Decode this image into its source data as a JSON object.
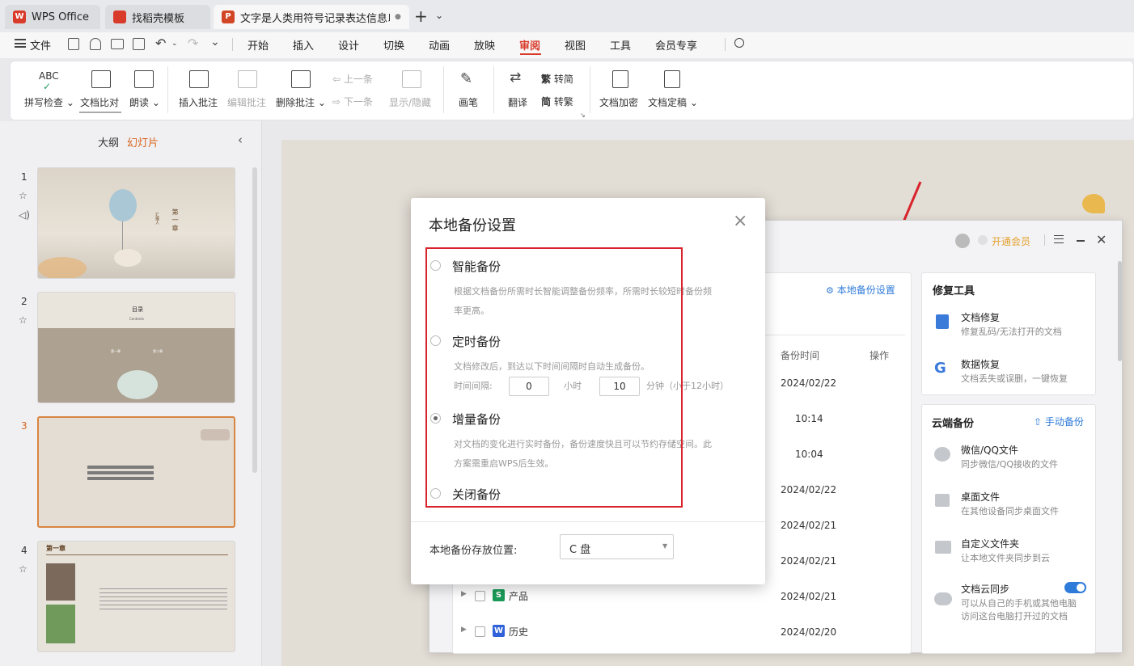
{
  "tabs": [
    {
      "label": "WPS Office",
      "color": "#d93b2b"
    },
    {
      "label": "找稻壳模板",
      "color": "#d93b2b"
    },
    {
      "label": "文字是人类用符号记录表达信息以",
      "color": "#d24625",
      "dot": "●"
    }
  ],
  "tab_add": "+",
  "tab_more": "⌄",
  "menu": {
    "file": "文件",
    "items": [
      "开始",
      "插入",
      "设计",
      "切换",
      "动画",
      "放映",
      "审阅",
      "视图",
      "工具",
      "会员专享"
    ],
    "active": "审阅"
  },
  "ribbon": {
    "spell_abc": "ABC",
    "spell_check": "拼写检查",
    "compare": "文档比对",
    "read_aloud": "朗读",
    "insert_comment": "插入批注",
    "edit_comment": "编辑批注",
    "delete_comment": "删除批注",
    "prev": "上一条",
    "next": "下一条",
    "show_hide": "显示/隐藏",
    "pen": "画笔",
    "translate": "翻译",
    "to_simplified": "转简",
    "to_traditional": "转繁",
    "simplified_char": "繁",
    "traditional_char": "简",
    "encrypt": "文档加密",
    "finalize": "文档定稿"
  },
  "left_pane": {
    "outline": "大纲",
    "slides": "幻灯片",
    "slide_numbers": [
      "1",
      "2",
      "3",
      "4"
    ],
    "slide1_title": "第一章",
    "slide1_sub": "汇报人",
    "slide2_title": "目录",
    "slide2_sub": "Contents",
    "slide2_item1": "第一章",
    "slide2_item2": "第二章",
    "slide4_title": "第一章"
  },
  "backup_window": {
    "vip": "开通会员",
    "local_backup_settings": "本地备份设置",
    "col_time": "备份时间",
    "col_action": "操作",
    "rows": [
      {
        "name": "",
        "date": "2024/02/22"
      },
      {
        "name": "",
        "date": "10:14"
      },
      {
        "name": "",
        "date": "10:04"
      },
      {
        "name": "",
        "date": "2024/02/22"
      },
      {
        "name": "",
        "date": "2024/02/21"
      },
      {
        "name": "",
        "date": "2024/02/21"
      },
      {
        "name": "产品",
        "date": "2024/02/21",
        "badge": "S",
        "badge_color": "#1a9b58"
      },
      {
        "name": "历史",
        "date": "2024/02/20",
        "badge": "W",
        "badge_color": "#2f62d9"
      }
    ],
    "repair_title": "修复工具",
    "repair_items": [
      {
        "title": "文档修复",
        "desc": "修复乱码/无法打开的文档"
      },
      {
        "title": "数据恢复",
        "desc": "文档丢失或误删，一键恢复"
      }
    ],
    "cloud_title": "云端备份",
    "manual_backup": "手动备份",
    "cloud_items": [
      {
        "title": "微信/QQ文件",
        "desc": "同步微信/QQ接收的文件"
      },
      {
        "title": "桌面文件",
        "desc": "在其他设备同步桌面文件"
      },
      {
        "title": "自定义文件夹",
        "desc": "让本地文件夹同步到云"
      },
      {
        "title": "文档云同步",
        "desc": "可以从自己的手机或其他电脑",
        "desc2": "访问这台电脑打开过的文档"
      }
    ]
  },
  "modal": {
    "title": "本地备份设置",
    "close": "×",
    "options": [
      {
        "label": "智能备份",
        "desc1": "根据文档备份所需时长智能调整备份频率，所需时长较短时备份频",
        "desc2": "率更高。",
        "selected": false
      },
      {
        "label": "定时备份",
        "desc1": "文档修改后，到达以下时间间隔时自动生成备份。",
        "selected": false
      },
      {
        "label": "增量备份",
        "desc1": "对文档的变化进行实时备份，备份速度快且可以节约存储空间。此",
        "desc2": "方案需重启WPS后生效。",
        "selected": true
      },
      {
        "label": "关闭备份",
        "selected": false
      }
    ],
    "interval_label": "时间间隔:",
    "hours_value": "0",
    "hours_unit": "小时",
    "minutes_value": "10",
    "minutes_unit": "分钟（小于12小时）",
    "location_label": "本地备份存放位置:",
    "location_value": "C 盘"
  },
  "colors": {
    "accent": "#d93b2b",
    "highlight_box": "#d9232b",
    "link": "#2f7bd9",
    "vip": "#e3a12f"
  }
}
